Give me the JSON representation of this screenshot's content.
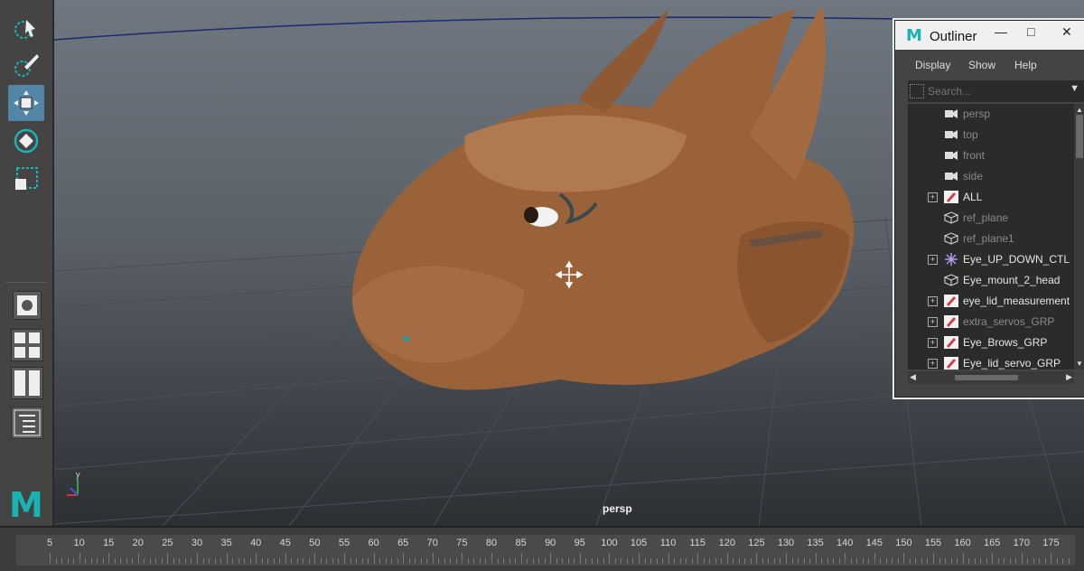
{
  "viewport": {
    "camera_label": "persp"
  },
  "toolbox": {
    "tools": [
      "select-tool",
      "paint-select-tool",
      "move-tool",
      "rotate-tool",
      "scale-tool"
    ],
    "active_tool": "move-tool",
    "app_logo": "M"
  },
  "outliner": {
    "title": "Outliner",
    "window_buttons": [
      "—",
      "□",
      "✕"
    ],
    "menu": [
      "Display",
      "Show",
      "Help"
    ],
    "search_placeholder": "Search...",
    "items": [
      {
        "label": "persp",
        "icon": "camera-icon",
        "expandable": false,
        "dimmed": true
      },
      {
        "label": "top",
        "icon": "camera-icon",
        "expandable": false,
        "dimmed": true
      },
      {
        "label": "front",
        "icon": "camera-icon",
        "expandable": false,
        "dimmed": true
      },
      {
        "label": "side",
        "icon": "camera-icon",
        "expandable": false,
        "dimmed": true
      },
      {
        "label": "ALL",
        "icon": "group-icon",
        "expandable": true,
        "dimmed": false
      },
      {
        "label": "ref_plane",
        "icon": "mesh-icon",
        "expandable": false,
        "dimmed": true
      },
      {
        "label": "ref_plane1",
        "icon": "mesh-icon",
        "expandable": false,
        "dimmed": true
      },
      {
        "label": "Eye_UP_DOWN_CTL",
        "icon": "locator-icon",
        "expandable": true,
        "dimmed": false
      },
      {
        "label": "Eye_mount_2_head",
        "icon": "mesh-icon",
        "expandable": false,
        "dimmed": false
      },
      {
        "label": "eye_lid_measurement",
        "icon": "group-icon",
        "expandable": true,
        "dimmed": false
      },
      {
        "label": "extra_servos_GRP",
        "icon": "group-icon",
        "expandable": true,
        "dimmed": true
      },
      {
        "label": "Eye_Brows_GRP",
        "icon": "group-icon",
        "expandable": true,
        "dimmed": false
      },
      {
        "label": "Eye_lid_servo_GRP",
        "icon": "group-icon",
        "expandable": true,
        "dimmed": false
      }
    ]
  },
  "timeline": {
    "ticks": [
      "5",
      "10",
      "15",
      "20",
      "25",
      "30",
      "35",
      "40",
      "45",
      "50",
      "55",
      "60",
      "65",
      "70",
      "75",
      "80",
      "85",
      "90",
      "95",
      "100",
      "105",
      "110",
      "115",
      "120",
      "125",
      "130",
      "135",
      "140",
      "145",
      "150",
      "155",
      "160",
      "165",
      "170",
      "175"
    ]
  },
  "colors": {
    "accent": "#5285a6",
    "maya_logo": "#19b3b4",
    "group_icon": "#d43a3a",
    "locator_icon": "#b49ae6"
  }
}
